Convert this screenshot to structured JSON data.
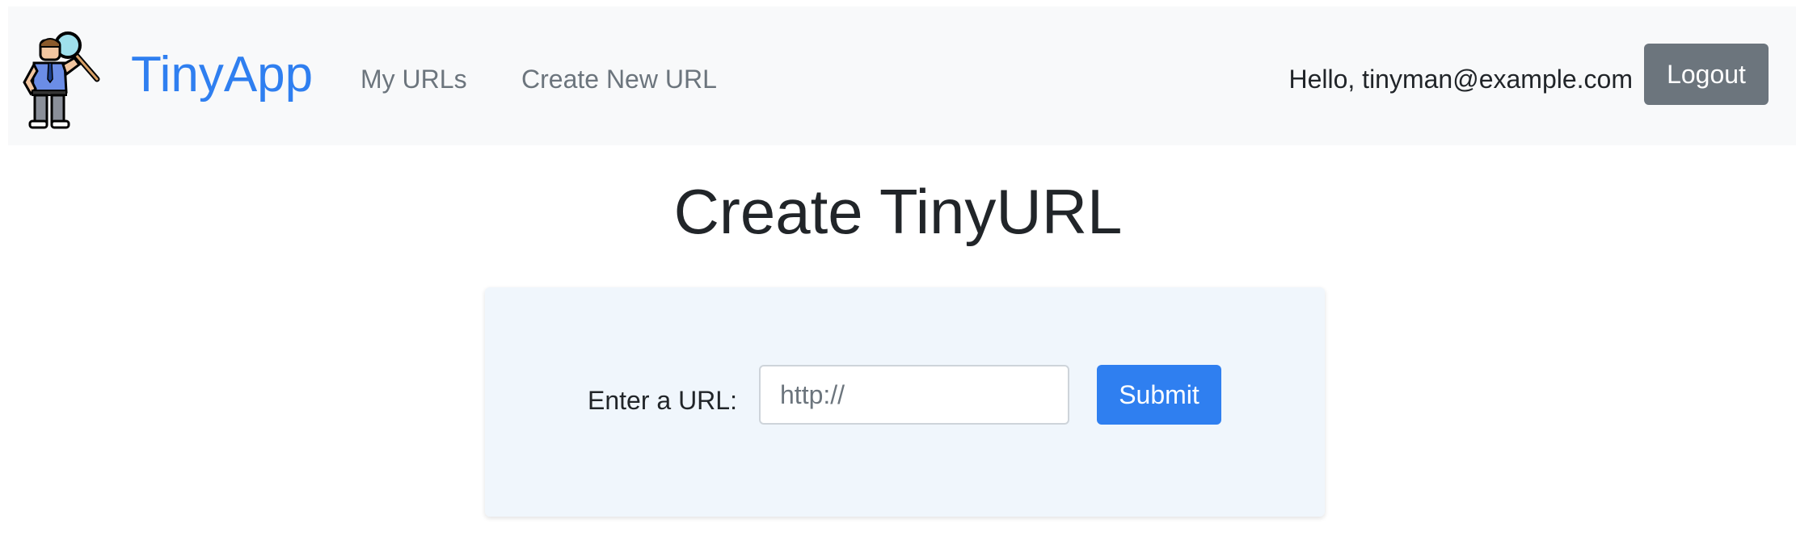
{
  "navbar": {
    "logo_icon": "detective-magnifier-icon",
    "brand": "TinyApp",
    "links": [
      {
        "label": "My URLs"
      },
      {
        "label": "Create New URL"
      }
    ],
    "greeting": "Hello, tinyman@example.com",
    "logout_label": "Logout"
  },
  "main": {
    "title": "Create TinyURL",
    "form": {
      "label": "Enter a URL:",
      "input_placeholder": "http://",
      "input_value": "",
      "submit_label": "Submit"
    }
  },
  "colors": {
    "brand": "#2f7ff0",
    "navbar_bg": "#f8f9fa",
    "card_bg": "#f0f6fc",
    "logout_bg": "#6c757d",
    "primary": "#2f7ff0"
  }
}
